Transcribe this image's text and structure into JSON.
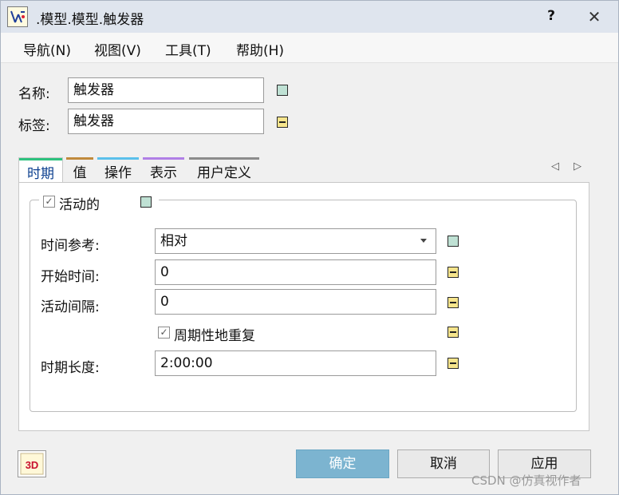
{
  "window": {
    "title": ".模型.模型.触发器",
    "help_label": "?",
    "close_label": "✕"
  },
  "menu": [
    {
      "label": "导航(N)"
    },
    {
      "label": "视图(V)"
    },
    {
      "label": "工具(T)"
    },
    {
      "label": "帮助(H)"
    }
  ],
  "fields": {
    "name_label": "名称:",
    "name_value": "触发器",
    "tag_label": "标签:",
    "tag_value": "触发器"
  },
  "tabs": [
    {
      "label": "时期",
      "color": "#2ec27e",
      "active": true
    },
    {
      "label": "值",
      "color": "#c08a3c"
    },
    {
      "label": "操作",
      "color": "#5bc0eb"
    },
    {
      "label": "表示",
      "color": "#b07fe6"
    },
    {
      "label": "用户定义",
      "color": "#8c8c8c"
    }
  ],
  "nav": {
    "prev": "◁",
    "next": "▷"
  },
  "period": {
    "active_checkbox": {
      "label": "活动的",
      "checked": true
    },
    "time_reference_label": "时间参考:",
    "time_reference_value": "相对",
    "start_time_label": "开始时间:",
    "start_time_value": "0",
    "active_interval_label": "活动间隔:",
    "active_interval_value": "0",
    "repeat_checkbox": {
      "label": "周期性地重复",
      "checked": true
    },
    "period_length_label": "时期长度:",
    "period_length_value": "2:00:00"
  },
  "buttons": {
    "ok": "确定",
    "cancel": "取消",
    "apply": "应用",
    "view3d": "3D"
  },
  "watermark": "CSDN @仿真视作者"
}
